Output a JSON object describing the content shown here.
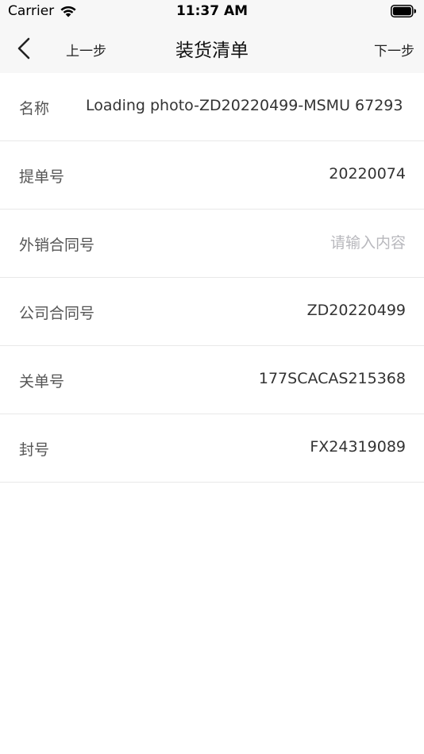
{
  "status_bar": {
    "carrier": "Carrier",
    "time": "11:37 AM"
  },
  "nav": {
    "back_icon": "chevron-left-icon",
    "prev_label": "上一步",
    "title": "装货清单",
    "next_label": "下一步"
  },
  "form": {
    "rows": [
      {
        "label": "名称",
        "value": "Loading photo-ZD20220499-MSMU 67293"
      },
      {
        "label": "提单号",
        "value": "20220074"
      },
      {
        "label": "外销合同号",
        "value": "",
        "placeholder": "请输入内容"
      },
      {
        "label": "公司合同号",
        "value": "ZD20220499"
      },
      {
        "label": "关单号",
        "value": "177SCACAS215368"
      },
      {
        "label": "封号",
        "value": "FX24319089"
      }
    ]
  },
  "colors": {
    "nav_background": "#f7f7f7",
    "divider": "#e8e8e8",
    "label_text": "#555555",
    "value_text": "#333333",
    "placeholder_text": "#b8b8bd"
  }
}
